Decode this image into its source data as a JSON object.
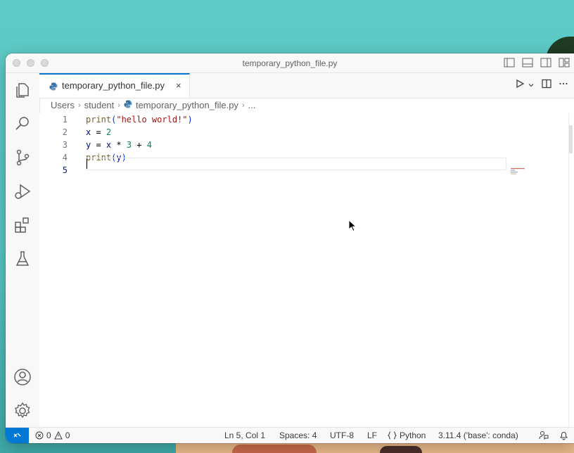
{
  "window": {
    "title": "temporary_python_file.py"
  },
  "tabs": [
    {
      "label": "temporary_python_file.py",
      "close": "×"
    }
  ],
  "breadcrumb": {
    "items": [
      "Users",
      "student",
      "temporary_python_file.py",
      "..."
    ]
  },
  "editor": {
    "line_numbers": [
      "1",
      "2",
      "3",
      "4",
      "5"
    ],
    "active_line": "5"
  },
  "statusbar": {
    "errors": "0",
    "warnings": "0",
    "position": "Ln 5, Col 1",
    "spaces": "Spaces: 4",
    "encoding": "UTF-8",
    "eol": "LF",
    "language": "Python",
    "interpreter": "3.11.4 ('base': conda)"
  },
  "icons": {
    "activity": [
      "files-icon",
      "search-icon",
      "source-control-icon",
      "run-debug-icon",
      "extensions-icon",
      "testing-icon",
      "account-icon",
      "manage-gear-icon"
    ],
    "accent": "#0078d4"
  }
}
